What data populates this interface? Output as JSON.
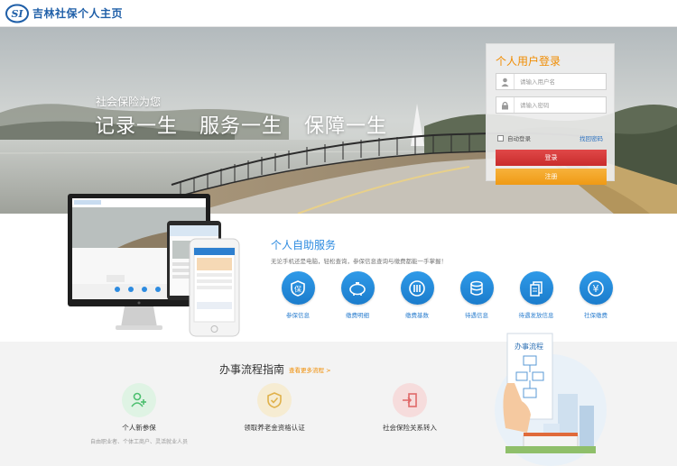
{
  "header": {
    "title": "吉林社保个人主页"
  },
  "hero": {
    "tagline": "社会保险为您",
    "slogan": "记录一生  服务一生  保障一生"
  },
  "login": {
    "title": "个人用户登录",
    "username_placeholder": "请输入用户名",
    "password_placeholder": "请输入密码",
    "remember_label": "自动登录",
    "forgot_link": "找回密码",
    "login_button": "登录",
    "register_button": "注册"
  },
  "self_service": {
    "title": "个人自助服务",
    "subtitle": "无论手机还是电脑，轻松查询，参保信息查询与缴费都能一手掌握！",
    "items": [
      {
        "label": "参保信息",
        "icon": "shield-icon"
      },
      {
        "label": "缴费明细",
        "icon": "piggy-bank-icon"
      },
      {
        "label": "缴费基数",
        "icon": "chart-bars-icon"
      },
      {
        "label": "待遇信息",
        "icon": "coins-icon"
      },
      {
        "label": "待遇发放信息",
        "icon": "documents-icon"
      },
      {
        "label": "社保缴费",
        "icon": "yen-icon"
      }
    ]
  },
  "guide": {
    "title": "办事流程指南",
    "more_link": "查看更多流程 >",
    "illustration_text": "办事流程",
    "items": [
      {
        "name": "个人新参保",
        "desc": "自由职业者、个体工商户、灵活就业人员",
        "icon": "add-user-icon",
        "color": "#4cbf6f",
        "bg": "#dff3e4"
      },
      {
        "name": "领取养老金资格认证",
        "desc": "",
        "icon": "shield-check-icon",
        "color": "#e0b14a",
        "bg": "#f6ecd2"
      },
      {
        "name": "社会保险关系转入",
        "desc": "",
        "icon": "transfer-in-icon",
        "color": "#e06a6a",
        "bg": "#f6dcdc"
      }
    ]
  },
  "colors": {
    "brand_blue": "#1f5fa8",
    "accent_orange": "#f08c00",
    "service_blue": "#2d8be0",
    "login_red": "#d43a3a",
    "register_orange": "#f2a223"
  }
}
